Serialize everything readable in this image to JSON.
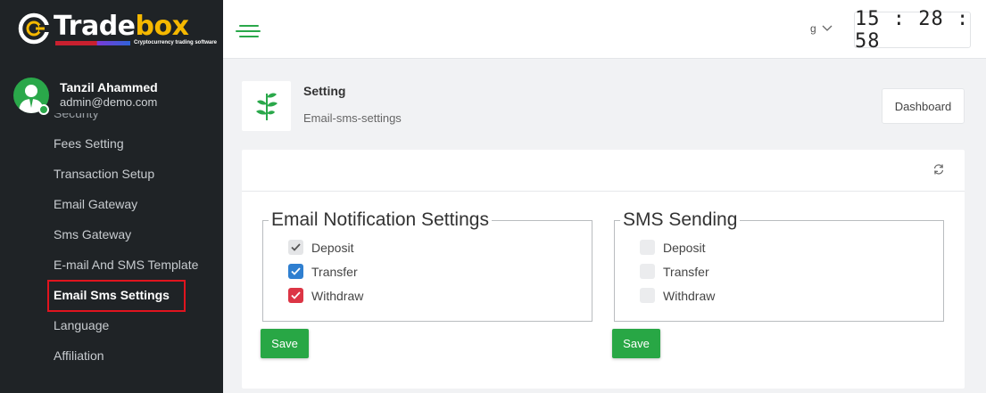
{
  "brand": {
    "name_part1": "Trade",
    "name_part2": "box",
    "tagline": "Cryptocurrency trading software"
  },
  "user": {
    "name": "Tanzil Ahammed",
    "email": "admin@demo.com"
  },
  "sidebar": {
    "items": [
      {
        "label": "Security"
      },
      {
        "label": "Fees Setting"
      },
      {
        "label": "Transaction Setup"
      },
      {
        "label": "Email Gateway"
      },
      {
        "label": "Sms Gateway"
      },
      {
        "label": "E-mail And SMS Template"
      },
      {
        "label": "Email Sms Settings",
        "active": true
      },
      {
        "label": "Language"
      },
      {
        "label": "Affiliation"
      }
    ]
  },
  "topbar": {
    "lang_label": "g",
    "clock": "15:28:58"
  },
  "page": {
    "title": "Setting",
    "subtitle": "Email-sms-settings",
    "dashboard_button": "Dashboard"
  },
  "email_settings": {
    "legend": "Email Notification Settings",
    "options": [
      {
        "label": "Deposit",
        "checked": true,
        "color": "#e4e5e7"
      },
      {
        "label": "Transfer",
        "checked": true,
        "color": "#2f7fd0"
      },
      {
        "label": "Withdraw",
        "checked": true,
        "color": "#dc3545"
      }
    ],
    "save_label": "Save"
  },
  "sms_settings": {
    "legend": "SMS Sending",
    "options": [
      {
        "label": "Deposit",
        "checked": false
      },
      {
        "label": "Transfer",
        "checked": false
      },
      {
        "label": "Withdraw",
        "checked": false
      }
    ],
    "save_label": "Save"
  },
  "colors": {
    "accent": "#28a745",
    "sidebar_bg": "#1f2326",
    "highlight": "#e0141e"
  },
  "icons": [
    "hamburger-icon",
    "chevron-down-icon",
    "leaf-icon",
    "refresh-icon",
    "check-icon",
    "user-avatar-icon"
  ]
}
